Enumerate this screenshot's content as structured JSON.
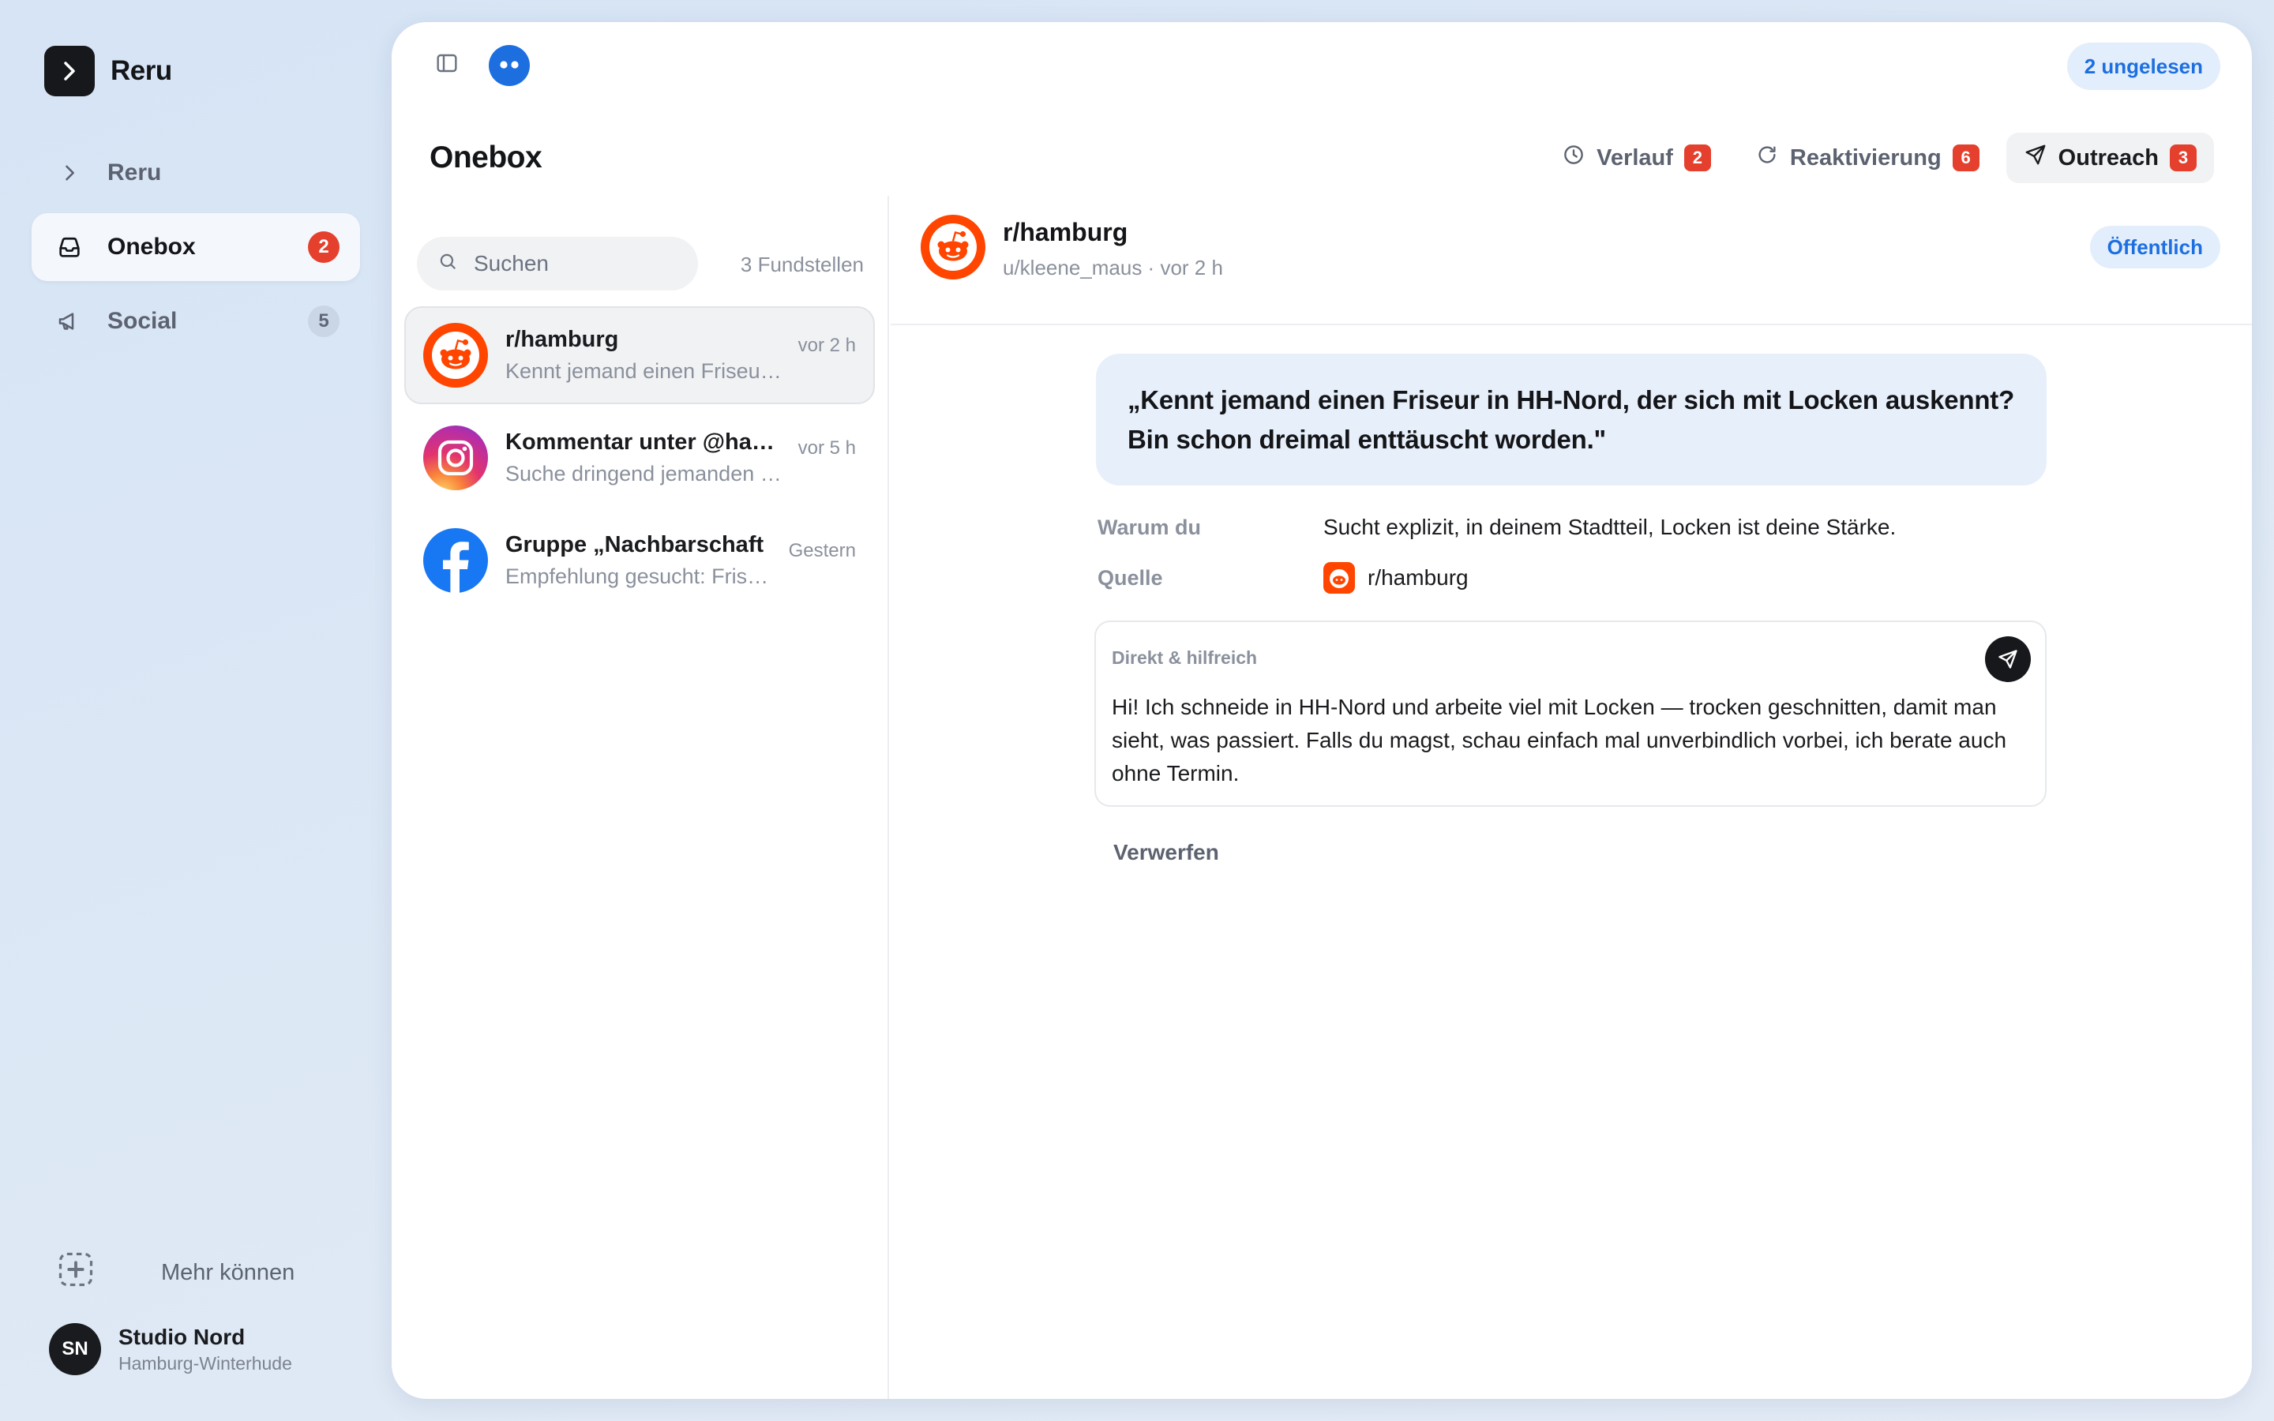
{
  "app": {
    "name": "Reru",
    "logo_icon": "chevron-right-icon"
  },
  "sidebar": {
    "items": [
      {
        "label": "Reru",
        "icon": "chevron-right-icon",
        "badge": ""
      },
      {
        "label": "Onebox",
        "icon": "inbox-icon",
        "badge": "2",
        "active": true
      },
      {
        "label": "Social",
        "icon": "megaphone-icon",
        "badge": "5"
      }
    ],
    "more_label": "Mehr können",
    "user": {
      "initials": "SN",
      "name": "Studio Nord",
      "location": "Hamburg-Winterhude"
    }
  },
  "topbar": {
    "unread_label": "2 ungelesen"
  },
  "page": {
    "title": "Onebox",
    "actions": [
      {
        "label": "Verlauf",
        "icon": "clock-icon",
        "badge": "2"
      },
      {
        "label": "Reaktivierung",
        "icon": "refresh-icon",
        "badge": "6"
      },
      {
        "label": "Outreach",
        "icon": "send-icon",
        "badge": "3",
        "active": true
      }
    ]
  },
  "list": {
    "search_placeholder": "Suchen",
    "found_label": "3 Fundstellen",
    "items": [
      {
        "title": "r/hamburg",
        "preview": "Kennt jemand einen Friseur in HH-Nord",
        "time": "vor 2 h",
        "source": "reddit",
        "active": true
      },
      {
        "title": "Kommentar unter @hamburg",
        "preview": "Suche dringend jemanden für",
        "time": "vor 5 h",
        "source": "instagram"
      },
      {
        "title": "Gruppe „Nachbarschaft",
        "preview": "Empfehlung gesucht: Friseur",
        "time": "Gestern",
        "source": "facebook"
      }
    ]
  },
  "detail": {
    "title": "r/hamburg",
    "subtitle": "u/kleene_maus · vor 2 h",
    "visibility": "Öffentlich",
    "quote": "„Kennt jemand einen Friseur in HH-Nord, der sich mit Locken auskennt? Bin schon dreimal enttäuscht worden.\"",
    "why_label": "Warum du",
    "why_value": "Sucht explizit, in deinem Stadtteil, Locken ist deine Stärke.",
    "source_label": "Quelle",
    "source_value": "r/hamburg",
    "draft_label": "Direkt & hilfreich",
    "draft_text": "Hi! Ich schneide in HH-Nord und arbeite viel mit Locken — trocken geschnitten, damit man sieht, was passiert. Falls du magst, schau einfach mal unverbindlich vorbei, ich berate auch ohne Termin.",
    "discard_label": "Verwerfen"
  },
  "colors": {
    "accent": "#1d6fe0",
    "badge_red": "#e5402d",
    "reddit": "#ff4500",
    "facebook": "#1877f2"
  }
}
